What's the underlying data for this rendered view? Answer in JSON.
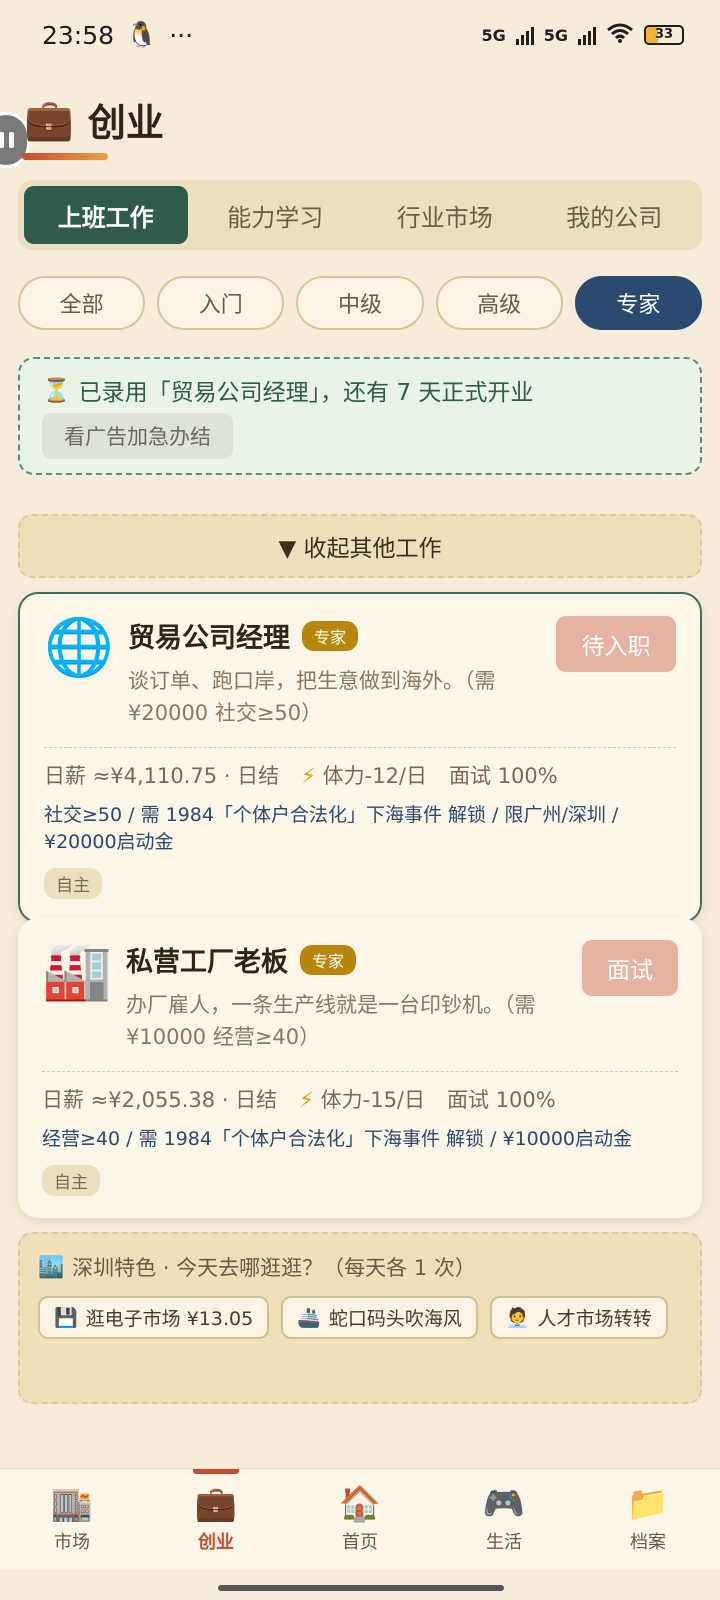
{
  "status": {
    "time": "23:58",
    "battery": "33"
  },
  "page": {
    "title": "创业",
    "title_icon": "briefcase-icon"
  },
  "tabs": [
    {
      "label": "上班工作",
      "active": true
    },
    {
      "label": "能力学习",
      "active": false
    },
    {
      "label": "行业市场",
      "active": false
    },
    {
      "label": "我的公司",
      "active": false
    }
  ],
  "filters": [
    {
      "label": "全部",
      "active": false
    },
    {
      "label": "入门",
      "active": false
    },
    {
      "label": "中级",
      "active": false
    },
    {
      "label": "高级",
      "active": false
    },
    {
      "label": "专家",
      "active": true
    }
  ],
  "notice": {
    "text": "已录用「贸易公司经理」，还有 7 天正式开业",
    "ad_button": "看广告加急办结"
  },
  "collapse": {
    "label": "▼ 收起其他工作"
  },
  "jobs": [
    {
      "title": "贸易公司经理",
      "level": "专家",
      "desc": "谈订单、跑口岸，把生意做到海外。（需 ¥20000 社交≥50）",
      "action": "待入职",
      "salary": "日薪 ≈¥4,110.75 · 日结",
      "stamina": "体力-12/日",
      "interview": "面试 100%",
      "requirements": "社交≥50 / 需 1984「个体户合法化」下海事件 解锁 / 限广州/深圳 / ¥20000启动金",
      "tag": "自主"
    },
    {
      "title": "私营工厂老板",
      "level": "专家",
      "desc": "办厂雇人，一条生产线就是一台印钞机。（需 ¥10000 经营≥40）",
      "action": "面试",
      "salary": "日薪 ≈¥2,055.38 · 日结",
      "stamina": "体力-15/日",
      "interview": "面试 100%",
      "requirements": "经营≥40 / 需 1984「个体户合法化」下海事件 解锁 / ¥10000启动金",
      "tag": "自主"
    }
  ],
  "explore": {
    "title": "深圳特色 · 今天去哪逛逛？（每天各 1 次）",
    "items": [
      {
        "label": "逛电子市场 ¥13.05"
      },
      {
        "label": "蛇口码头吹海风"
      },
      {
        "label": "人才市场转转"
      }
    ]
  },
  "nav": [
    {
      "label": "市场",
      "active": false
    },
    {
      "label": "创业",
      "active": true
    },
    {
      "label": "首页",
      "active": false
    },
    {
      "label": "生活",
      "active": false
    },
    {
      "label": "档案",
      "active": false
    }
  ],
  "colors": {
    "primary_green": "#2f5c4c",
    "accent_blue": "#2b4a70",
    "accent_red": "#c94a2e",
    "background": "#f6ecd9"
  }
}
